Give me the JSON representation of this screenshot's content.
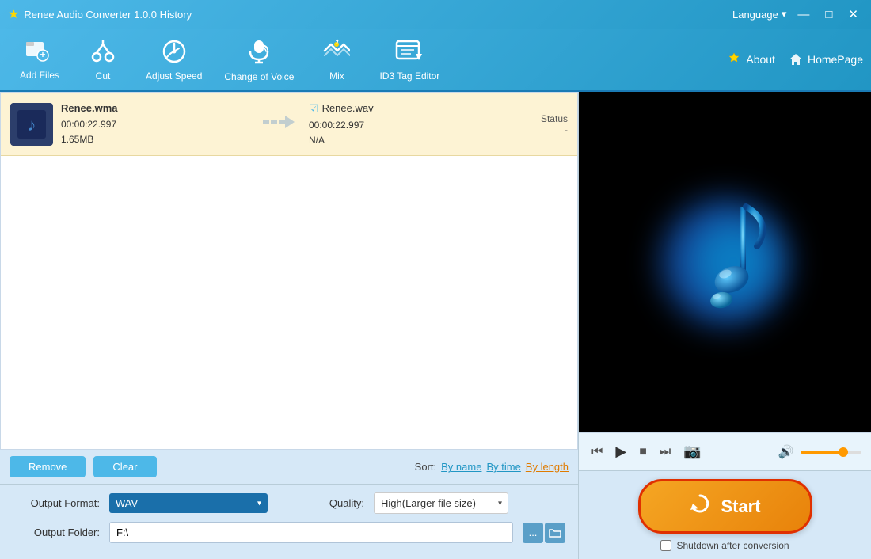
{
  "app": {
    "title": "Renee Audio Converter 1.0.0  History",
    "logo_icon": "★"
  },
  "titlebar": {
    "language_label": "Language",
    "language_arrow": "▾",
    "minimize": "—",
    "maximize": "□",
    "close": "✕"
  },
  "toolbar": {
    "add_files_label": "Add Files",
    "cut_label": "Cut",
    "adjust_speed_label": "Adjust Speed",
    "change_voice_label": "Change of Voice",
    "mix_label": "Mix",
    "id3_tag_label": "ID3 Tag Editor",
    "about_label": "About",
    "homepage_label": "HomePage"
  },
  "file_list": {
    "items": [
      {
        "input_filename": "Renee.wma",
        "input_duration": "00:00:22.997",
        "input_size": "1.65MB",
        "output_filename": "Renee.wav",
        "output_duration": "00:00:22.997",
        "output_extra": "N/A",
        "status_label": "Status",
        "status_value": "-"
      }
    ]
  },
  "action_bar": {
    "remove_label": "Remove",
    "clear_label": "Clear",
    "sort_label": "Sort:",
    "sort_by_name": "By name",
    "sort_by_time": "By time",
    "sort_by_length": "By length"
  },
  "settings": {
    "output_format_label": "Output Format:",
    "output_format_value": "WAV",
    "quality_label": "Quality:",
    "quality_value": "High(Larger file size)",
    "output_folder_label": "Output Folder:",
    "output_folder_value": "F:\\",
    "browse_btn": "...",
    "folder_btn": "🗀"
  },
  "player": {
    "skip_back_icon": "⏮",
    "play_icon": "▶",
    "stop_icon": "■",
    "skip_forward_icon": "⏭",
    "camera_icon": "📷",
    "volume_icon": "🔊",
    "volume_percent": 70
  },
  "start_area": {
    "start_label": "Start",
    "start_icon": "🔄",
    "shutdown_label": "Shutdown after conversion",
    "shutdown_checked": false
  }
}
